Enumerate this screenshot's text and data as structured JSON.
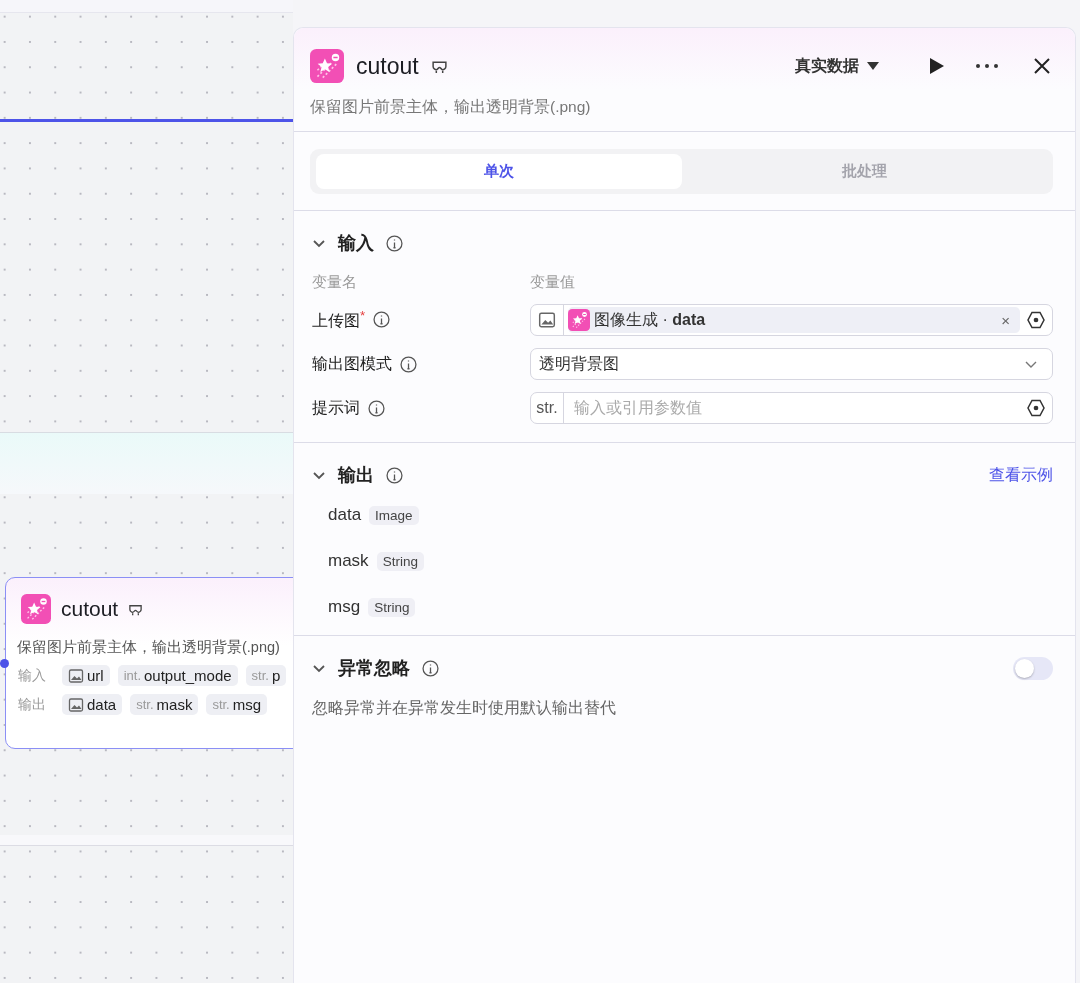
{
  "canvas": {
    "node": {
      "title": "cutout",
      "description": "保留图片前景主体，输出透明背景(.png)",
      "inputs_label": "输入",
      "outputs_label": "输出",
      "inputs": [
        {
          "kind": "image",
          "name": "url"
        },
        {
          "kind": "typed",
          "type": "int.",
          "name": "output_mode"
        },
        {
          "kind": "typed",
          "type": "str.",
          "name": "p"
        }
      ],
      "outputs": [
        {
          "kind": "image",
          "name": "data"
        },
        {
          "kind": "typed",
          "type": "str.",
          "name": "mask"
        },
        {
          "kind": "typed",
          "type": "str.",
          "name": "msg"
        }
      ]
    }
  },
  "panel": {
    "title": "cutout",
    "description": "保留图片前景主体，输出透明背景(.png)",
    "data_mode": "真实数据",
    "tabs": [
      {
        "label": "单次",
        "selected": true
      },
      {
        "label": "批处理",
        "selected": false
      }
    ],
    "input_section": {
      "title": "输入",
      "columns": [
        "变量名",
        "变量值"
      ],
      "required_mark": "*",
      "clear": "×",
      "params": [
        {
          "kind": "ref",
          "label": "上传图",
          "required": true,
          "value": "图像生成 · **data**"
        },
        {
          "kind": "select",
          "label": "输出图模式",
          "required": false,
          "value": "透明背景图"
        },
        {
          "kind": "text",
          "label": "提示词",
          "required": false,
          "type": "str.",
          "placeholder": "输入或引用参数值"
        }
      ]
    },
    "output_section": {
      "title": "输出",
      "link": "查看示例",
      "fields": [
        {
          "name": "data",
          "type": "Image"
        },
        {
          "name": "mask",
          "type": "String"
        },
        {
          "name": "msg",
          "type": "String"
        }
      ]
    },
    "error_section": {
      "title": "异常忽略",
      "on": false,
      "description": "忽略异常并在异常发生时使用默认输出替代"
    }
  }
}
